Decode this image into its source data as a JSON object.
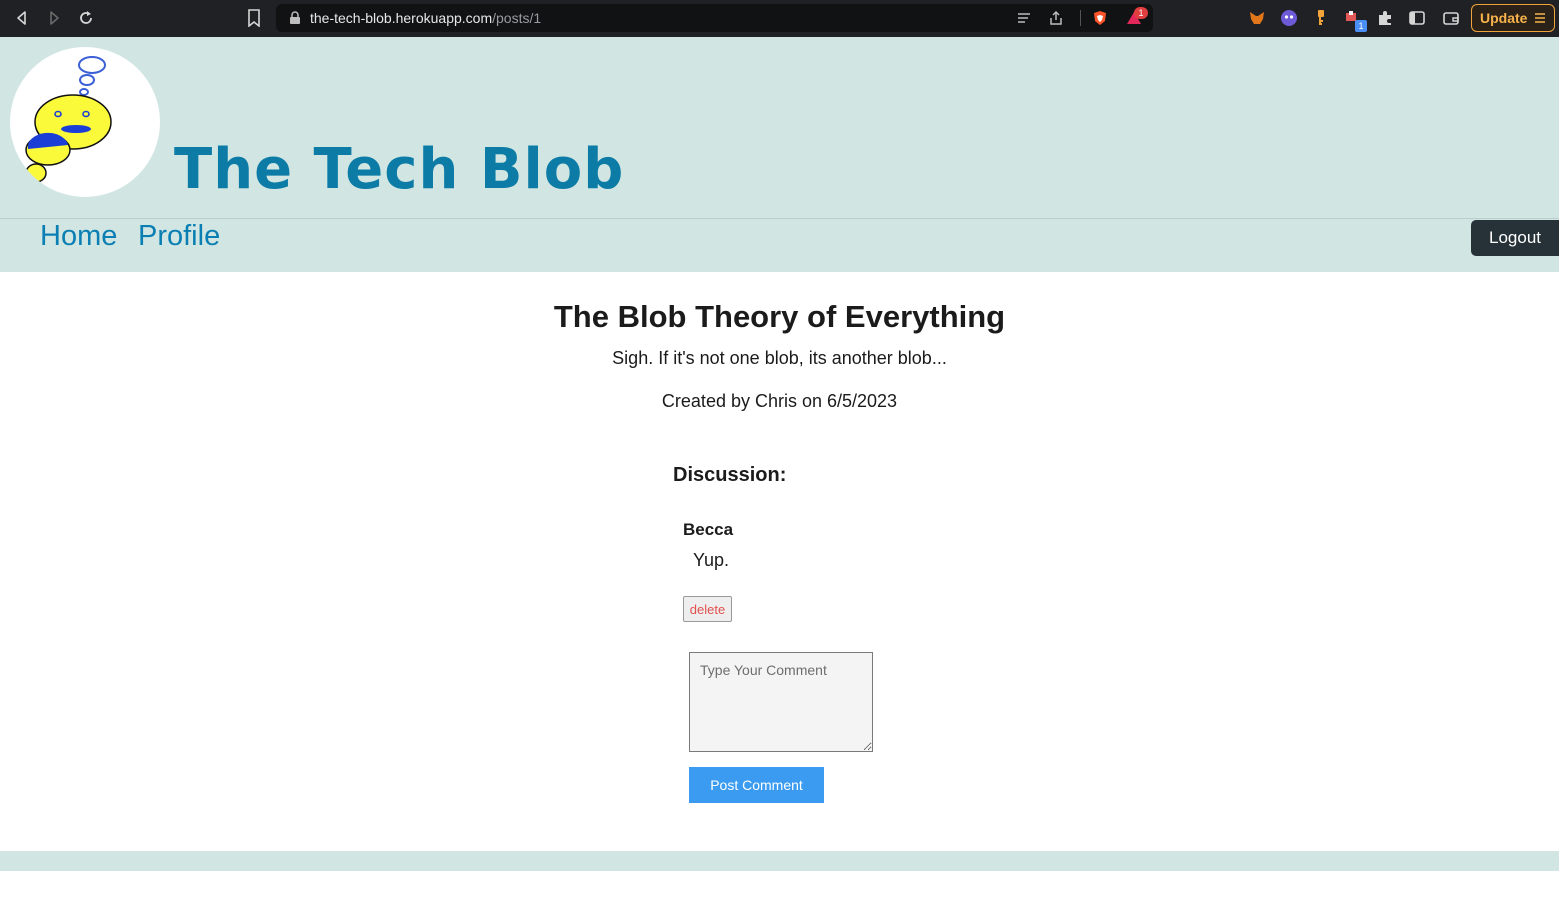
{
  "browser": {
    "url_host": "the-tech-blob.herokuapp.com",
    "url_path": "/posts/1",
    "update_label": "Update",
    "notification_badge": "1",
    "extension_badge": "1"
  },
  "site": {
    "title": "The Tech Blob",
    "brand_color": "#0c7ca6",
    "header_bg": "#d1e6e3"
  },
  "nav": {
    "home": "Home",
    "profile": "Profile",
    "logout": "Logout"
  },
  "post": {
    "title": "The Blob Theory of Everything",
    "body": "Sigh. If it's not one blob, its another blob...",
    "meta": "Created by Chris on 6/5/2023"
  },
  "discussion": {
    "heading": "Discussion:",
    "comments": [
      {
        "author": "Becca",
        "text": "Yup.",
        "delete_label": "delete"
      }
    ],
    "input_placeholder": "Type Your Comment",
    "submit_label": "Post Comment"
  }
}
